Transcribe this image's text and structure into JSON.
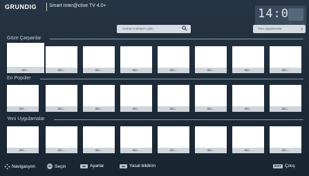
{
  "header": {
    "brand": "GRUNDIG",
    "subtitle": "Smart Inter@ctive TV 4.0+",
    "clock": "14:00"
  },
  "search": {
    "placeholder": "Arama Anahtarını girin",
    "icon": "search-icon"
  },
  "apps_button": {
    "label": "Tüm uygulamalar",
    "icon": "chevron-right-icon"
  },
  "sections": [
    {
      "title": "Göze Çarpanlar",
      "tiles": [
        "abc...",
        "abc...",
        "abc...",
        "abc...",
        "abc...",
        "abc...",
        "abc...",
        "abc..."
      ]
    },
    {
      "title": "En Popüler",
      "tiles": [
        "abc...",
        "abc...",
        "abc...",
        "abc...",
        "abc...",
        "abc...",
        "abc...",
        "abc..."
      ]
    },
    {
      "title": "Yeni Uygulamalar",
      "tiles": [
        "abc...",
        "abc...",
        "abc...",
        "abc...",
        "abc...",
        "abc...",
        "abc...",
        "abc..."
      ]
    }
  ],
  "footer": {
    "navigate": "Navigasyon",
    "ok_key": "OK",
    "select": "Seçin",
    "settings_key": "▬",
    "settings": "Ayarlar",
    "legal_key": "▬",
    "legal": "Yasal bildirim",
    "exit_key": "EXIT",
    "exit": "Çıkış"
  },
  "colors": {
    "background": "#1e2b39",
    "tile": "#ffffff",
    "tile_label_bg": "#cfd6dd",
    "search_bg": "#d5dbe1"
  }
}
